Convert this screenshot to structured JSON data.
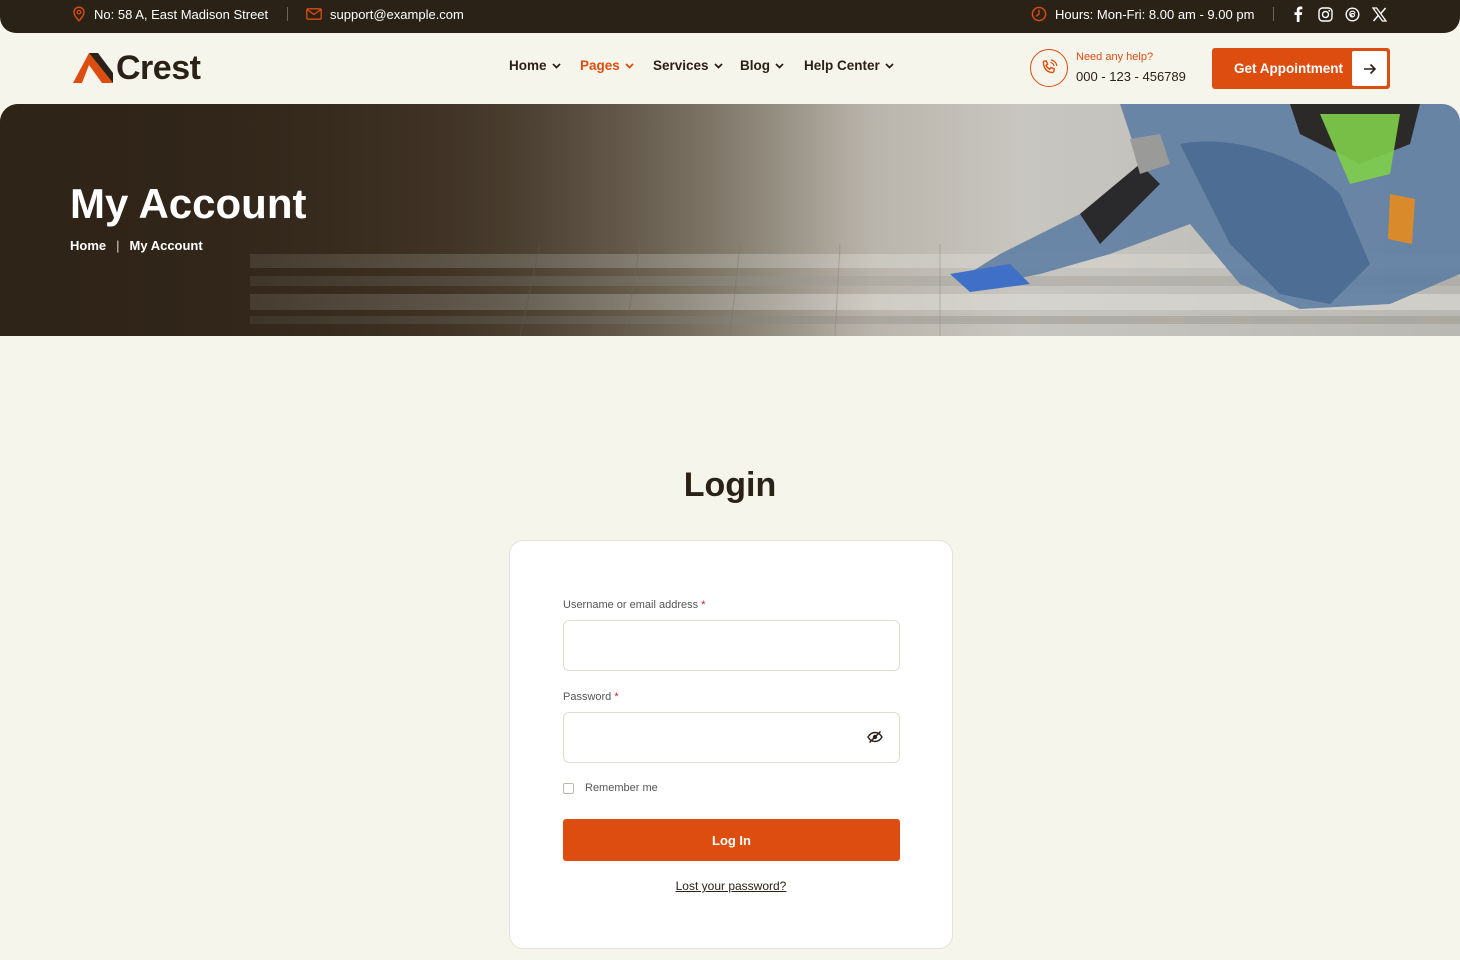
{
  "topbar": {
    "address": "No: 58 A, East Madison Street",
    "email": "support@example.com",
    "hours": "Hours: Mon-Fri: 8.00 am - 9.00 pm",
    "social": [
      "facebook-icon",
      "instagram-icon",
      "threads-icon",
      "x-icon"
    ]
  },
  "header": {
    "logo": "Crest",
    "nav": [
      {
        "label": "Home",
        "active": false
      },
      {
        "label": "Pages",
        "active": true
      },
      {
        "label": "Services",
        "active": false
      },
      {
        "label": "Blog",
        "active": false
      },
      {
        "label": "Help Center",
        "active": false
      }
    ],
    "help_label": "Need any help?",
    "help_phone": "000 - 123 - 456789",
    "cta_label": "Get Appointment"
  },
  "hero": {
    "title": "My Account",
    "breadcrumb_home": "Home",
    "breadcrumb_current": "My Account"
  },
  "login": {
    "title": "Login",
    "username_label": "Username or email address",
    "username_value": "",
    "password_label": "Password",
    "password_value": "",
    "required_mark": "*",
    "remember_label": "Remember me",
    "remember_checked": false,
    "submit_label": "Log In",
    "lost_password": "Lost your password?"
  },
  "colors": {
    "accent": "#dd4d10",
    "dark": "#2b2217",
    "background": "#f6f5ec"
  }
}
